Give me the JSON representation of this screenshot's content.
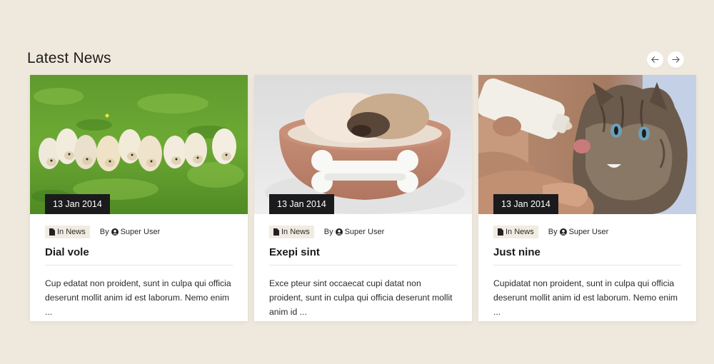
{
  "section": {
    "title": "Latest News"
  },
  "navigation": {
    "prev_icon": "arrow-left-icon",
    "next_icon": "arrow-right-icon"
  },
  "cards": [
    {
      "image": "puppies-on-grass",
      "date": "13 Jan 2014",
      "category": "In News",
      "category_icon": "document-icon",
      "author_prefix": "By",
      "author_icon": "user-circle-icon",
      "author": "Super User",
      "title": "Dial vole",
      "excerpt": "Cup edatat non proident, sunt in culpa qui officia deserunt mollit anim id est laborum. Nemo enim ..."
    },
    {
      "image": "puppy-in-bowl",
      "date": "13 Jan 2014",
      "category": "In News",
      "category_icon": "document-icon",
      "author_prefix": "By",
      "author_icon": "user-circle-icon",
      "author": "Super User",
      "title": "Exepi sint",
      "excerpt": "Exce pteur sint occaecat cupi datat non proident, sunt in culpa qui officia deserunt mollit anim id ..."
    },
    {
      "image": "kitten-with-bottle",
      "date": "13 Jan 2014",
      "category": "In News",
      "category_icon": "document-icon",
      "author_prefix": "By",
      "author_icon": "user-circle-icon",
      "author": "Super User",
      "title": "Just nine",
      "excerpt": "Cupidatat non proident, sunt in culpa qui officia deserunt mollit anim id est laborum. Nemo enim ..."
    }
  ],
  "colors": {
    "background": "#efe8dc",
    "card": "#ffffff",
    "badge": "#1b1b1d",
    "tag": "#f2ebe1"
  }
}
